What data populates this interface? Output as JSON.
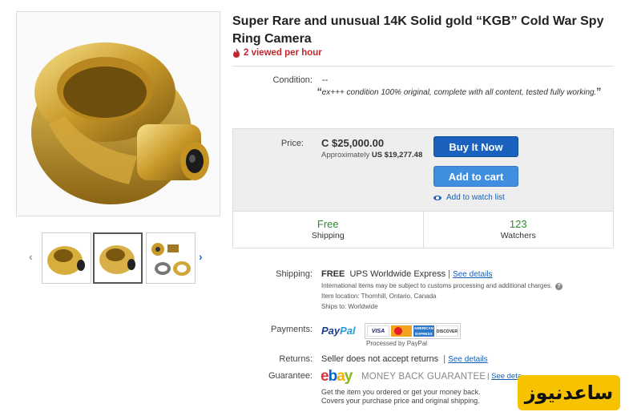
{
  "listing": {
    "title": "Super Rare and unusual 14K Solid gold “KGB” Cold War Spy Ring Camera",
    "viewed": "2 viewed per hour"
  },
  "condition": {
    "label": "Condition:",
    "value": "--",
    "quote": "ex+++ condition 100% original, complete with all content, tested fully working."
  },
  "price": {
    "label": "Price:",
    "value": "C $25,000.00",
    "approx_prefix": "Approximately",
    "approx_value": "US $19,277.48",
    "buy_now": "Buy It Now",
    "add_to_cart": "Add to cart",
    "watch_list": "Add to watch list"
  },
  "stats": {
    "shipping_value": "Free",
    "shipping_label": "Shipping",
    "watchers_value": "123",
    "watchers_label": "Watchers"
  },
  "shipping": {
    "label": "Shipping:",
    "free": "FREE",
    "service": "UPS Worldwide Express",
    "see_details": "See details",
    "note1": "International items may be subject to customs processing and additional charges.",
    "note2": "Item location:  Thornhill, Ontario, Canada",
    "note3": "Ships to:  Worldwide"
  },
  "payments": {
    "label": "Payments:",
    "paypal_a": "Pay",
    "paypal_b": "Pal",
    "processed": "Processed by PayPal",
    "cards": [
      "VISA",
      "",
      "AMERICAN EXPRESS",
      "DISCOVER"
    ]
  },
  "returns": {
    "label": "Returns:",
    "value": "Seller does not accept returns",
    "see_details": "See details"
  },
  "guarantee": {
    "label": "Guarantee:",
    "logo_e": "e",
    "logo_b": "b",
    "logo_a": "a",
    "logo_y": "y",
    "mbg": "MONEY BACK GUARANTEE",
    "see_details": "See deta",
    "note1": "Get the item you ordered or get your money back.",
    "note2": "Covers your purchase price and original shipping."
  },
  "gallery": {
    "prev": "‹",
    "next": "›"
  },
  "watermark": "ساعدنیوز",
  "colors": {
    "buy_now": "#1a62bd",
    "add_to_cart": "#3f8ee0",
    "viewed": "#c0282d",
    "free_green": "#2e8b2e"
  }
}
